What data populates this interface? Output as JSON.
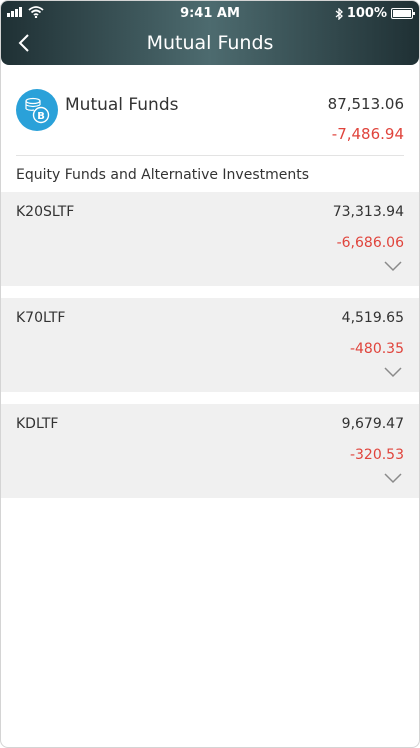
{
  "status_bar": {
    "time": "9:41 AM",
    "battery": "100%",
    "icons": [
      "signal-icon",
      "wifi-icon",
      "bluetooth-icon",
      "battery-icon"
    ]
  },
  "header": {
    "title": "Mutual Funds",
    "back_icon": "chevron-left-icon"
  },
  "summary": {
    "icon": "coins-icon",
    "title": "Mutual Funds",
    "value": "87,513.06",
    "change": "-7,486.94"
  },
  "section": {
    "title": "Equity Funds and Alternative Investments"
  },
  "funds": [
    {
      "name": "K20SLTF",
      "value": "73,313.94",
      "change": "-6,686.06"
    },
    {
      "name": "K70LTF",
      "value": "4,519.65",
      "change": "-480.35"
    },
    {
      "name": "KDLTF",
      "value": "9,679.47",
      "change": "-320.53"
    }
  ],
  "colors": {
    "negative": "#e0443c",
    "accent": "#2aa1d9",
    "header_dark": "#1f3034",
    "header_light": "#4d6b6f",
    "row_bg": "#f0f0f0"
  }
}
